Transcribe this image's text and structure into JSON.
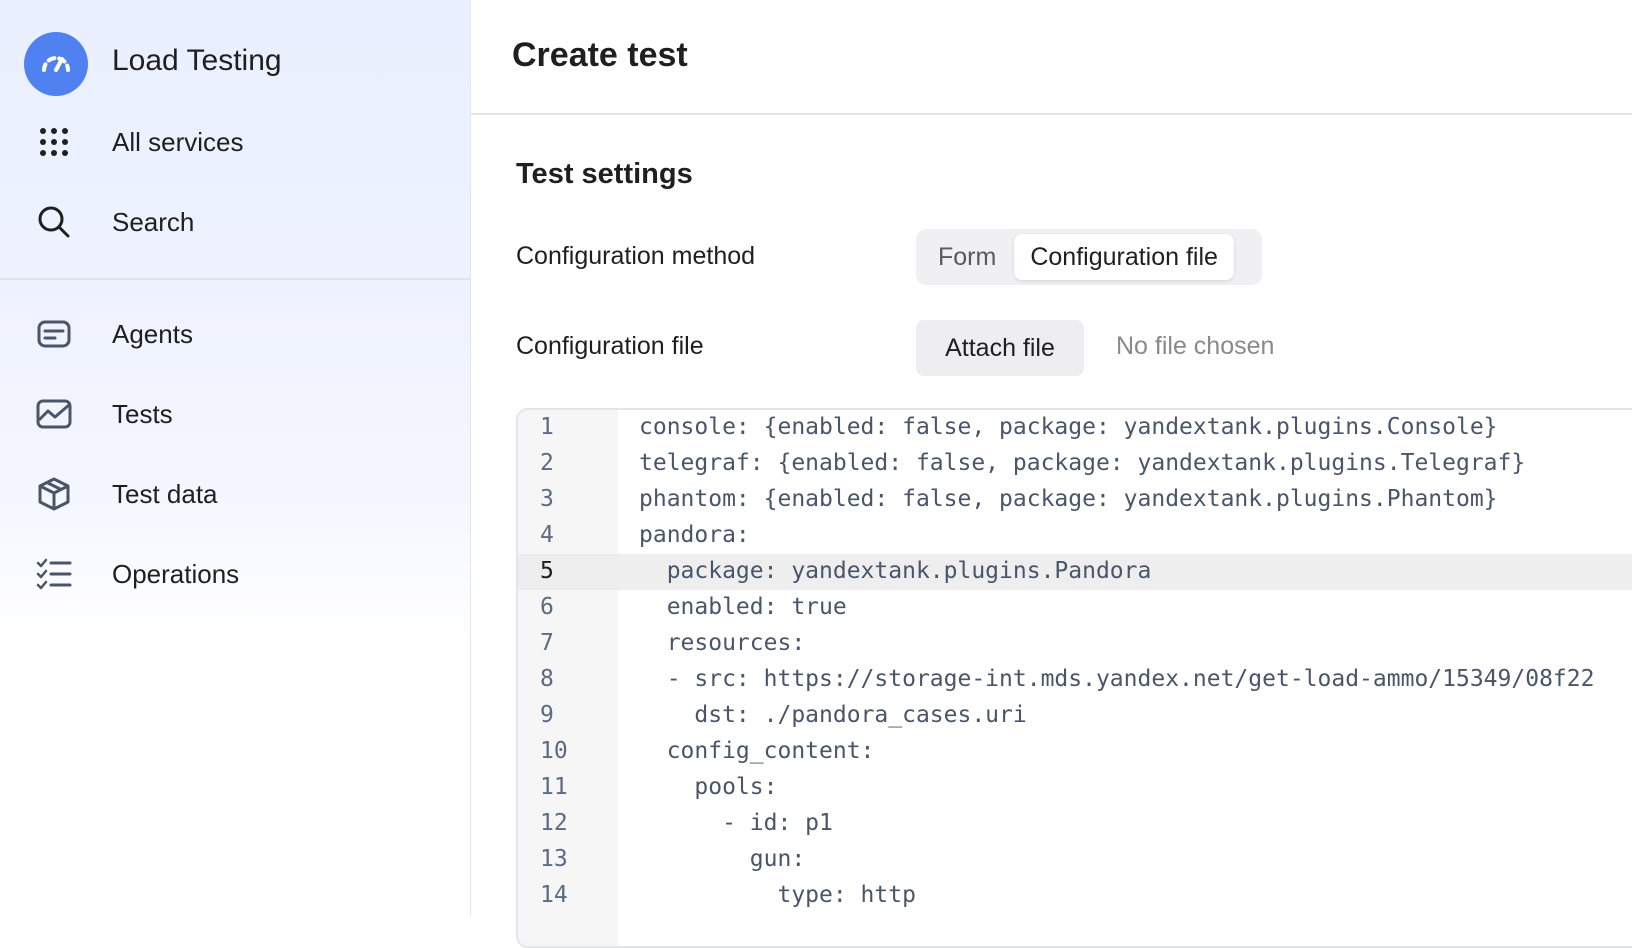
{
  "sidebar": {
    "brand": {
      "label": "Load Testing",
      "icon": "speedometer-icon",
      "color": "#4f82f0"
    },
    "top_items": [
      {
        "label": "All services",
        "icon": "grid-dots-icon"
      },
      {
        "label": "Search",
        "icon": "search-icon"
      }
    ],
    "nav_items": [
      {
        "label": "Agents",
        "icon": "agent-card-icon"
      },
      {
        "label": "Tests",
        "icon": "chart-area-icon"
      },
      {
        "label": "Test data",
        "icon": "package-box-icon"
      },
      {
        "label": "Operations",
        "icon": "checklist-icon"
      }
    ]
  },
  "main": {
    "title": "Create test",
    "section_title": "Test settings",
    "config_method": {
      "label": "Configuration method",
      "options": [
        "Form",
        "Configuration file"
      ],
      "selected": "Configuration file"
    },
    "config_file": {
      "label": "Configuration file",
      "button_label": "Attach file",
      "status": "No file chosen"
    },
    "editor": {
      "highlighted_line": 5,
      "lines": [
        {
          "n": "1",
          "text": "console: {enabled: false, package: yandextank.plugins.Console}"
        },
        {
          "n": "2",
          "text": "telegraf: {enabled: false, package: yandextank.plugins.Telegraf}"
        },
        {
          "n": "3",
          "text": "phantom: {enabled: false, package: yandextank.plugins.Phantom}"
        },
        {
          "n": "4",
          "text": "pandora:"
        },
        {
          "n": "5",
          "text": "  package: yandextank.plugins.Pandora"
        },
        {
          "n": "6",
          "text": "  enabled: true"
        },
        {
          "n": "7",
          "text": "  resources:"
        },
        {
          "n": "8",
          "text": "  - src: https://storage-int.mds.yandex.net/get-load-ammo/15349/08f22"
        },
        {
          "n": "9",
          "text": "    dst: ./pandora_cases.uri"
        },
        {
          "n": "10",
          "text": "  config_content:"
        },
        {
          "n": "11",
          "text": "    pools:"
        },
        {
          "n": "12",
          "text": "      - id: p1"
        },
        {
          "n": "13",
          "text": "        gun:"
        },
        {
          "n": "14",
          "text": "          type: http"
        }
      ]
    }
  }
}
